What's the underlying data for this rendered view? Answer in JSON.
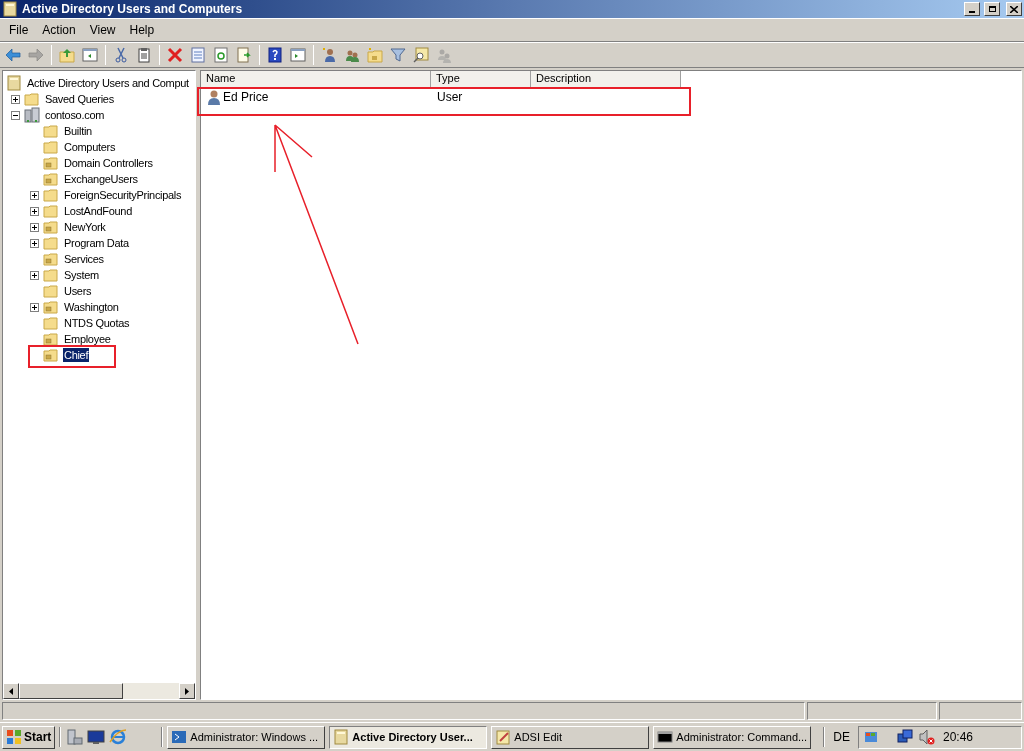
{
  "window": {
    "title": "Active Directory Users and Computers"
  },
  "menu": [
    "File",
    "Action",
    "View",
    "Help"
  ],
  "toolbar": [
    {
      "kind": "back",
      "disabled": false
    },
    {
      "kind": "forward",
      "disabled": true
    },
    {
      "kind": "sep"
    },
    {
      "kind": "up",
      "disabled": false
    },
    {
      "kind": "tree",
      "disabled": false
    },
    {
      "kind": "sep"
    },
    {
      "kind": "cut",
      "disabled": false
    },
    {
      "kind": "paste",
      "disabled": false
    },
    {
      "kind": "sep"
    },
    {
      "kind": "delete",
      "disabled": false
    },
    {
      "kind": "properties",
      "disabled": false
    },
    {
      "kind": "refresh",
      "disabled": false
    },
    {
      "kind": "export",
      "disabled": false
    },
    {
      "kind": "sep"
    },
    {
      "kind": "help",
      "disabled": false
    },
    {
      "kind": "pane",
      "disabled": false
    },
    {
      "kind": "sep"
    },
    {
      "kind": "newuser",
      "disabled": false
    },
    {
      "kind": "newgroup",
      "disabled": false
    },
    {
      "kind": "newou",
      "disabled": false
    },
    {
      "kind": "filter",
      "disabled": false
    },
    {
      "kind": "find",
      "disabled": false
    },
    {
      "kind": "addgroup",
      "disabled": true
    }
  ],
  "tree": {
    "label": "Active Directory Users and Comput",
    "kind": "console",
    "selected": false,
    "children": [
      {
        "label": "Saved Queries",
        "kind": "folder",
        "expanded": false,
        "selected": false
      },
      {
        "label": "contoso.com",
        "kind": "domain",
        "expanded": true,
        "selected": false,
        "children": [
          {
            "label": "Builtin",
            "kind": "folder",
            "selected": false
          },
          {
            "label": "Computers",
            "kind": "folder",
            "selected": false
          },
          {
            "label": "Domain Controllers",
            "kind": "ou",
            "selected": false
          },
          {
            "label": "ExchangeUsers",
            "kind": "ou",
            "selected": false
          },
          {
            "label": "ForeignSecurityPrincipals",
            "kind": "folder",
            "expanded": false,
            "selected": false
          },
          {
            "label": "LostAndFound",
            "kind": "folder",
            "expanded": false,
            "selected": false
          },
          {
            "label": "NewYork",
            "kind": "ou",
            "expanded": false,
            "selected": false
          },
          {
            "label": "Program Data",
            "kind": "folder",
            "expanded": false,
            "selected": false
          },
          {
            "label": "Services",
            "kind": "ou",
            "selected": false
          },
          {
            "label": "System",
            "kind": "folder",
            "expanded": false,
            "selected": false
          },
          {
            "label": "Users",
            "kind": "folder",
            "selected": false
          },
          {
            "label": "Washington",
            "kind": "ou",
            "expanded": false,
            "selected": false
          },
          {
            "label": "NTDS Quotas",
            "kind": "folder",
            "selected": false
          },
          {
            "label": "Employee",
            "kind": "ou",
            "selected": false
          },
          {
            "label": "Chief",
            "kind": "ou",
            "selected": true
          }
        ]
      }
    ]
  },
  "list": {
    "columns": [
      "Name",
      "Type",
      "Description"
    ],
    "rows": [
      {
        "name": "Ed Price",
        "type": "User"
      }
    ]
  },
  "taskbar": {
    "start": "Start",
    "tasks": [
      {
        "label": "Administrator: Windows ...",
        "kind": "powershell",
        "selected": false
      },
      {
        "label": "Active Directory User...",
        "kind": "console",
        "selected": true
      },
      {
        "label": "ADSI Edit",
        "kind": "edit",
        "selected": false
      },
      {
        "label": "Administrator: Command...",
        "kind": "cmd",
        "selected": false
      }
    ],
    "language": "DE",
    "clock": "20:46"
  }
}
